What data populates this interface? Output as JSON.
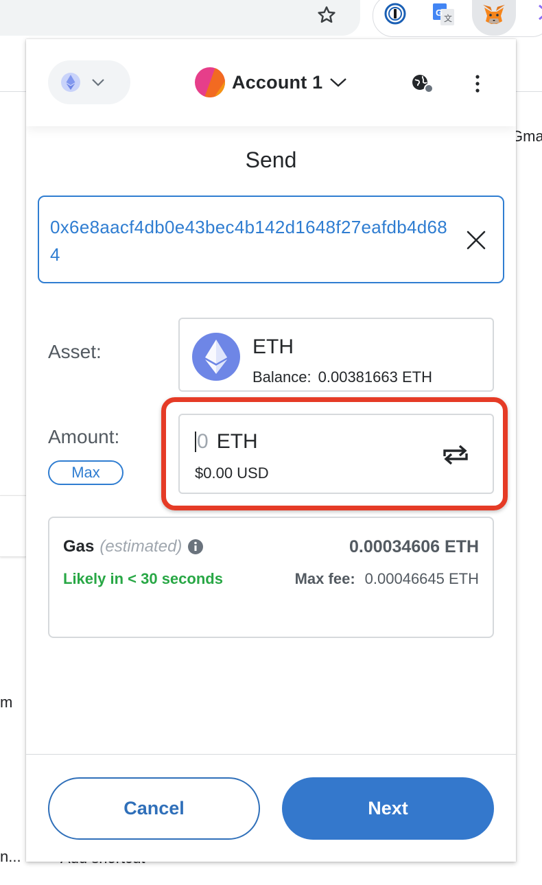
{
  "background": {
    "right_partial_text": "Gma",
    "left_partial_text": "m",
    "bottom_left_text": "n...",
    "bottom_partial_text": "Add shortcut"
  },
  "header": {
    "network_icon": "ethereum-icon",
    "account_name": "Account 1",
    "colors": {
      "avatar_a": "#e63e8a",
      "avatar_b": "#f26a21"
    }
  },
  "send": {
    "title": "Send",
    "recipient_address": "0x6e8aacf4db0e43bec4b142d1648f27eafdb4d684"
  },
  "asset": {
    "label": "Asset:",
    "name": "ETH",
    "balance_label": "Balance:",
    "balance_value": "0.00381663 ETH"
  },
  "amount": {
    "label": "Amount:",
    "max_label": "Max",
    "value": "0",
    "unit": "ETH",
    "fiat": "$0.00 USD"
  },
  "gas": {
    "title": "Gas",
    "estimated": "(estimated)",
    "amount": "0.00034606 ETH",
    "likely": "Likely in < 30 seconds",
    "max_fee_label": "Max fee:",
    "max_fee_value": "0.00046645 ETH"
  },
  "footer": {
    "cancel_label": "Cancel",
    "next_label": "Next"
  },
  "colors": {
    "accent": "#2f7dd1",
    "primary_button": "#3478cc",
    "highlight": "#e53b26",
    "success": "#28a745"
  }
}
